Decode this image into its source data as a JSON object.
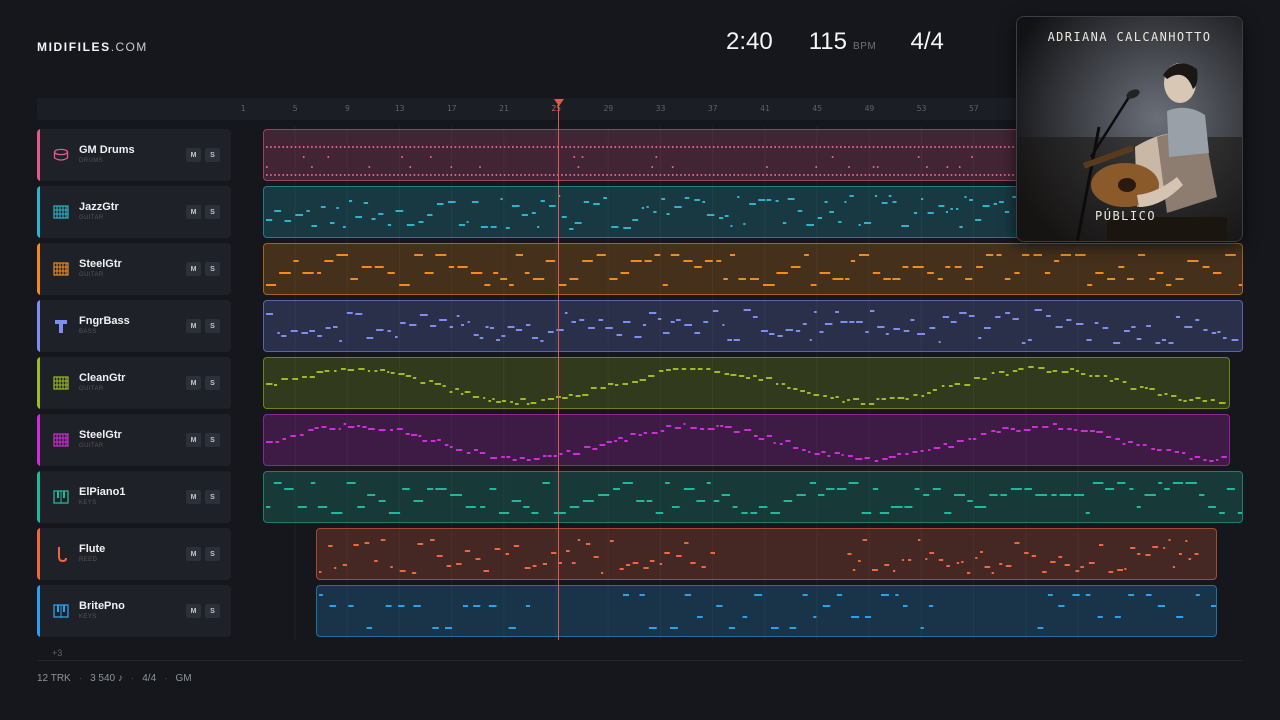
{
  "brand": {
    "name": "MIDIFILES",
    "domain": ".COM"
  },
  "transport": {
    "time": "2:40",
    "tempo": "115",
    "tempo_unit": "BPM",
    "meter": "4/4"
  },
  "ruler": {
    "bars": [
      "1",
      "5",
      "9",
      "13",
      "17",
      "21",
      "25",
      "29",
      "33",
      "37",
      "41",
      "45",
      "49",
      "53",
      "57"
    ]
  },
  "playhead": {
    "bar": 25
  },
  "tracks": [
    {
      "name": "GM Drums",
      "category": "DRUMS",
      "color": "#e35a8c",
      "icon": "drum-icon",
      "mute": "M",
      "solo": "S"
    },
    {
      "name": "JazzGtr",
      "category": "GUITAR",
      "color": "#2bb4cc",
      "icon": "guitar-icon",
      "mute": "M",
      "solo": "S"
    },
    {
      "name": "SteelGtr",
      "category": "GUITAR",
      "color": "#f08c1e",
      "icon": "guitar-icon",
      "mute": "M",
      "solo": "S"
    },
    {
      "name": "FngrBass",
      "category": "BASS",
      "color": "#7d8ef0",
      "icon": "bass-icon",
      "mute": "M",
      "solo": "S"
    },
    {
      "name": "CleanGtr",
      "category": "GUITAR",
      "color": "#9cbc24",
      "icon": "guitar-icon",
      "mute": "M",
      "solo": "S"
    },
    {
      "name": "SteelGtr",
      "category": "GUITAR",
      "color": "#d02dd8",
      "icon": "guitar-icon",
      "mute": "M",
      "solo": "S"
    },
    {
      "name": "ElPiano1",
      "category": "KEYS",
      "color": "#20b89c",
      "icon": "keys-icon",
      "mute": "M",
      "solo": "S"
    },
    {
      "name": "Flute",
      "category": "REED",
      "color": "#f0673e",
      "icon": "reed-icon",
      "mute": "M",
      "solo": "S"
    },
    {
      "name": "BritePno",
      "category": "KEYS",
      "color": "#2ba0ec",
      "icon": "keys-icon",
      "mute": "M",
      "solo": "S"
    }
  ],
  "more_tracks": "+3",
  "footer": {
    "tracks": "12 TRK",
    "notes": "3 540 ♪",
    "meter": "4/4",
    "standard": "GM"
  },
  "cover": {
    "artist": "ADRIANA CALCANHOTTO",
    "album": "PÚBLICO"
  }
}
